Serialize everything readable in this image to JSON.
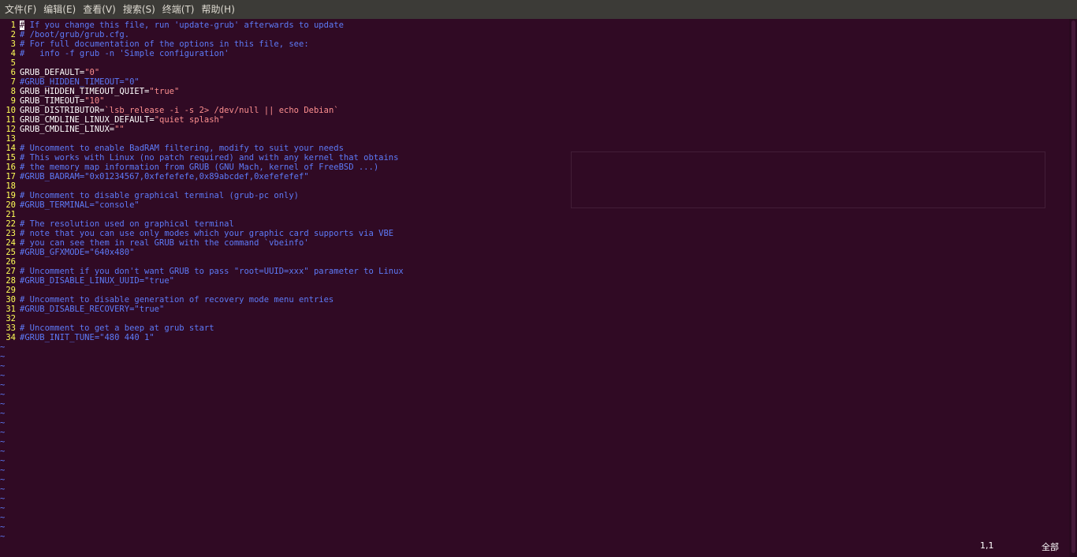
{
  "menubar": {
    "items": [
      "文件(F)",
      "编辑(E)",
      "查看(V)",
      "搜索(S)",
      "终端(T)",
      "帮助(H)"
    ]
  },
  "editor": {
    "lines": [
      {
        "n": "1",
        "t": "# If you change this file, run 'update-grub' afterwards to update",
        "k": "cursorcomment"
      },
      {
        "n": "2",
        "t": "# /boot/grub/grub.cfg.",
        "k": "comment"
      },
      {
        "n": "3",
        "t": "# For full documentation of the options in this file, see:",
        "k": "comment"
      },
      {
        "n": "4",
        "t": "#   info -f grub -n 'Simple configuration'",
        "k": "comment"
      },
      {
        "n": "5",
        "t": "",
        "k": "plain"
      },
      {
        "n": "6",
        "t": "GRUB_DEFAULT=",
        "v": "\"0\"",
        "k": "kv"
      },
      {
        "n": "7",
        "t": "#GRUB_HIDDEN_TIMEOUT=\"0\"",
        "k": "comment"
      },
      {
        "n": "8",
        "t": "GRUB_HIDDEN_TIMEOUT_QUIET=",
        "v": "\"true\"",
        "k": "kv"
      },
      {
        "n": "9",
        "t": "GRUB_TIMEOUT=",
        "v": "\"10\"",
        "k": "kv"
      },
      {
        "n": "10",
        "t": "GRUB_DISTRIBUTOR=",
        "v": "`lsb_release -i -s 2> /dev/null || echo Debian`",
        "k": "kv"
      },
      {
        "n": "11",
        "t": "GRUB_CMDLINE_LINUX_DEFAULT=",
        "v": "\"quiet splash\"",
        "k": "kv"
      },
      {
        "n": "12",
        "t": "GRUB_CMDLINE_LINUX=",
        "v": "\"\"",
        "k": "kv"
      },
      {
        "n": "13",
        "t": "",
        "k": "plain"
      },
      {
        "n": "14",
        "t": "# Uncomment to enable BadRAM filtering, modify to suit your needs",
        "k": "comment"
      },
      {
        "n": "15",
        "t": "# This works with Linux (no patch required) and with any kernel that obtains",
        "k": "comment"
      },
      {
        "n": "16",
        "t": "# the memory map information from GRUB (GNU Mach, kernel of FreeBSD ...)",
        "k": "comment"
      },
      {
        "n": "17",
        "t": "#GRUB_BADRAM=\"0x01234567,0xfefefefe,0x89abcdef,0xefefefef\"",
        "k": "comment"
      },
      {
        "n": "18",
        "t": "",
        "k": "plain"
      },
      {
        "n": "19",
        "t": "# Uncomment to disable graphical terminal (grub-pc only)",
        "k": "comment"
      },
      {
        "n": "20",
        "t": "#GRUB_TERMINAL=\"console\"",
        "k": "comment"
      },
      {
        "n": "21",
        "t": "",
        "k": "plain"
      },
      {
        "n": "22",
        "t": "# The resolution used on graphical terminal",
        "k": "comment"
      },
      {
        "n": "23",
        "t": "# note that you can use only modes which your graphic card supports via VBE",
        "k": "comment"
      },
      {
        "n": "24",
        "t": "# you can see them in real GRUB with the command `vbeinfo'",
        "k": "comment"
      },
      {
        "n": "25",
        "t": "#GRUB_GFXMODE=\"640x480\"",
        "k": "comment"
      },
      {
        "n": "26",
        "t": "",
        "k": "plain"
      },
      {
        "n": "27",
        "t": "# Uncomment if you don't want GRUB to pass \"root=UUID=xxx\" parameter to Linux",
        "k": "comment"
      },
      {
        "n": "28",
        "t": "#GRUB_DISABLE_LINUX_UUID=\"true\"",
        "k": "comment"
      },
      {
        "n": "29",
        "t": "",
        "k": "plain"
      },
      {
        "n": "30",
        "t": "# Uncomment to disable generation of recovery mode menu entries",
        "k": "comment"
      },
      {
        "n": "31",
        "t": "#GRUB_DISABLE_RECOVERY=\"true\"",
        "k": "comment"
      },
      {
        "n": "32",
        "t": "",
        "k": "plain"
      },
      {
        "n": "33",
        "t": "# Uncomment to get a beep at grub start",
        "k": "comment"
      },
      {
        "n": "34",
        "t": "#GRUB_INIT_TUNE=\"480 440 1\"",
        "k": "comment"
      }
    ],
    "tilde_count": 21,
    "tilde_char": "~"
  },
  "status": {
    "position": "1,1",
    "scroll": "全部"
  },
  "colors": {
    "background": "#300a24",
    "line_number": "#ffff57",
    "comment": "#5d7af7",
    "string": "#fd8f8f",
    "text": "#ffffff"
  }
}
